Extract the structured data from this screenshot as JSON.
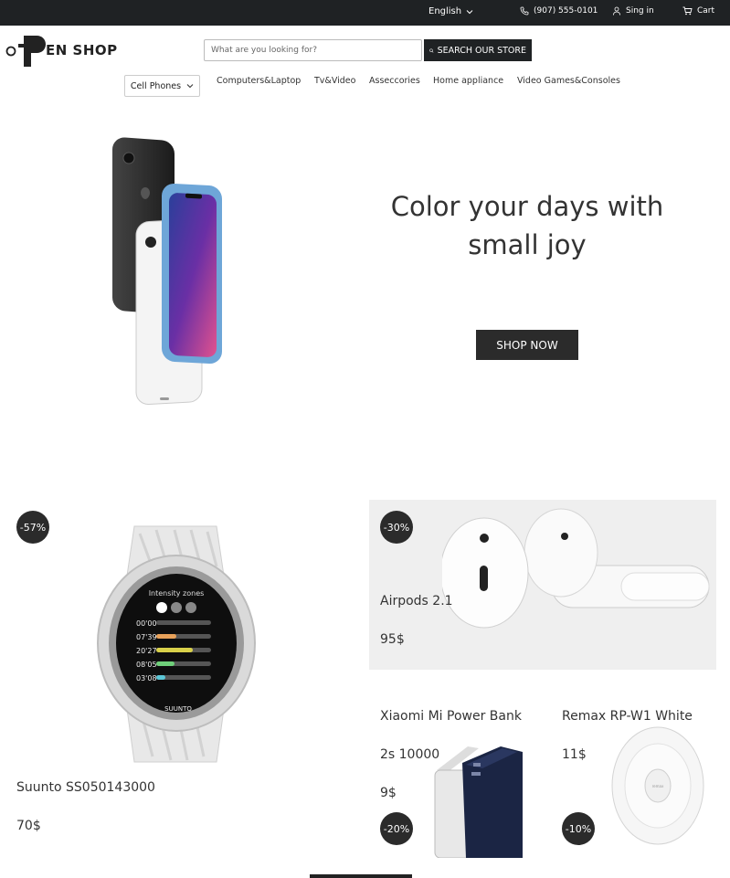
{
  "topbar": {
    "language": "English",
    "phone": "(907) 555-0101",
    "signin": "Sing in",
    "cart": "Cart"
  },
  "logo": {
    "text": "EN SHOP"
  },
  "search": {
    "placeholder": "What are you looking for?",
    "button": "SEARCH OUR STORE"
  },
  "nav": {
    "category_select": "Cell Phones",
    "links": [
      "Computers&Laptop",
      "Tv&Video",
      "Asseccories",
      "Home appliance",
      "Video Games&Consoles"
    ]
  },
  "hero": {
    "title_line1": "Color your days with",
    "title_line2": "small joy",
    "button": "SHOP NOW"
  },
  "products": [
    {
      "name": "Suunto SS050143000",
      "price": "70$",
      "discount": "-57%"
    },
    {
      "name": "Airpods 2.1",
      "price": "95$",
      "discount": "-30%"
    },
    {
      "name_line1": "Xiaomi Mi Power Bank",
      "name_line2": "2s 10000",
      "price": "9$",
      "discount": "-20%"
    },
    {
      "name": "Remax RP-W1 White",
      "price": "11$",
      "discount": "-10%"
    }
  ],
  "watch_screen": {
    "title": "Intensity zones",
    "times": [
      "00'00",
      "07'39",
      "20'27",
      "08'05",
      "03'08"
    ],
    "brand": "SUUNTO"
  },
  "colors": {
    "dark": "#1f2224",
    "zone_orange": "#e8a15a",
    "zone_yellow": "#d9d14a",
    "zone_green": "#6fcf7a",
    "zone_blue": "#5cc6d6"
  }
}
